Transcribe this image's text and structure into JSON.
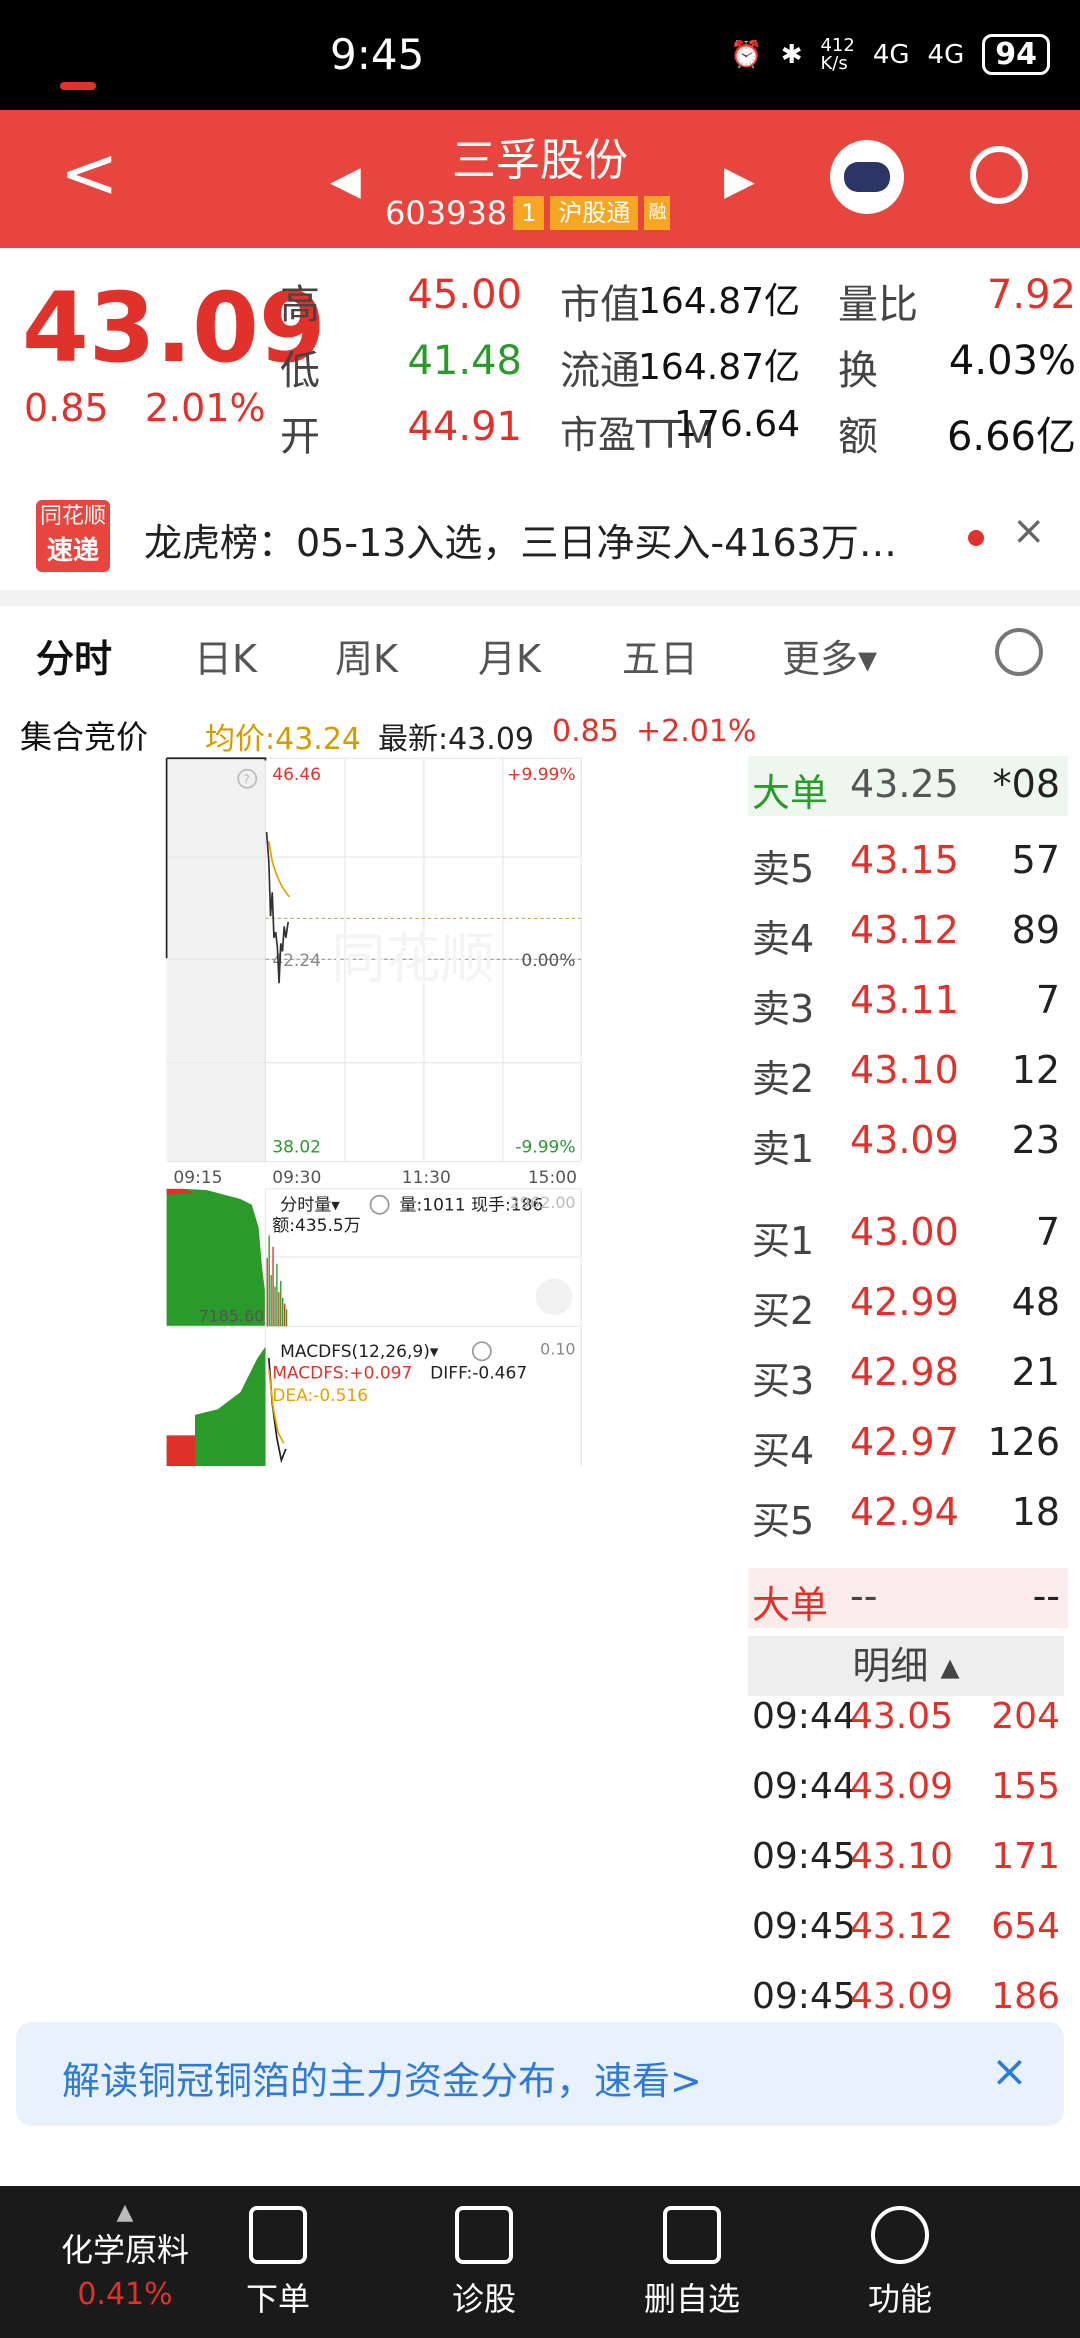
{
  "status": {
    "time": "9:45",
    "net_speed": "412\nK/s",
    "signal1": "4G",
    "signal2": "4G",
    "battery": "94"
  },
  "header": {
    "back": "<",
    "stock_name": "三孚股份",
    "stock_code": "603938",
    "tag_level": "1",
    "tag_connect": "沪股通",
    "tag_extra": "融"
  },
  "quote": {
    "price": "43.09",
    "change": "0.85",
    "change_pct": "2.01%",
    "rows": [
      {
        "l1": "高",
        "v1": "45.00",
        "c1": "red",
        "l2": "市值",
        "v2": "164.87亿",
        "l3": "量比",
        "v3": "7.92",
        "c3": "red"
      },
      {
        "l1": "低",
        "v1": "41.48",
        "c1": "green",
        "l2": "流通",
        "v2": "164.87亿",
        "l3": "换",
        "v3": "4.03%",
        "c3": "black"
      },
      {
        "l1": "开",
        "v1": "44.91",
        "c1": "red",
        "l2": "市盈TTM",
        "v2": "176.64",
        "l3": "额",
        "v3": "6.66亿",
        "c3": "black"
      }
    ]
  },
  "lhb": {
    "logo_top": "同花顺",
    "logo_bottom": "速递",
    "text": "龙虎榜：05-13入选，三日净买入-4163万…",
    "close": "×"
  },
  "tabs": [
    "分时",
    "日K",
    "周K",
    "月K",
    "五日",
    "更多▾"
  ],
  "info": {
    "auction": "集合竞价",
    "avg": "均价:43.24",
    "latest": "最新:43.09",
    "chg": "0.85",
    "pct": "+2.01%"
  },
  "chart": {
    "top_price": "46.46",
    "top_pct": "+9.99%",
    "mid_price": "42.24",
    "mid_pct": "0.00%",
    "bottom_price": "38.02",
    "bottom_pct": "-9.99%",
    "times": [
      "09:15",
      "09:30",
      "11:30",
      "15:00"
    ],
    "vol_label": "分时量▾",
    "vol_info": "量:1011  现手:186",
    "vol_max": "2962.00",
    "amount": "额:435.5万",
    "auction_val": "7185.60",
    "macd_label": "MACDFS(12,26,9)▾",
    "macd_max": "0.10",
    "macd_val": "MACDFS:+0.097",
    "diff": "DIFF:-0.467",
    "dea": "DEA:-0.516",
    "watermark": "同花顺"
  },
  "big_order": {
    "label": "大单",
    "price": "43.25",
    "vol": "*08"
  },
  "asks": [
    {
      "label": "卖5",
      "price": "43.15",
      "vol": "57"
    },
    {
      "label": "卖4",
      "price": "43.12",
      "vol": "89"
    },
    {
      "label": "卖3",
      "price": "43.11",
      "vol": "7"
    },
    {
      "label": "卖2",
      "price": "43.10",
      "vol": "12"
    },
    {
      "label": "卖1",
      "price": "43.09",
      "vol": "23"
    }
  ],
  "bids": [
    {
      "label": "买1",
      "price": "43.00",
      "vol": "7"
    },
    {
      "label": "买2",
      "price": "42.99",
      "vol": "48"
    },
    {
      "label": "买3",
      "price": "42.98",
      "vol": "21"
    },
    {
      "label": "买4",
      "price": "42.97",
      "vol": "126"
    },
    {
      "label": "买5",
      "price": "42.94",
      "vol": "18"
    }
  ],
  "big_order2": {
    "label": "大单",
    "price": "--",
    "vol": "--"
  },
  "detail": {
    "label": "明细 ▴"
  },
  "ticks": [
    {
      "time": "09:44",
      "price": "43.05",
      "vol": "204"
    },
    {
      "time": "09:44",
      "price": "43.09",
      "vol": "155"
    },
    {
      "time": "09:45",
      "price": "43.10",
      "vol": "171"
    },
    {
      "time": "09:45",
      "price": "43.12",
      "vol": "654"
    },
    {
      "time": "09:45",
      "price": "43.09",
      "vol": "186"
    }
  ],
  "ad": {
    "text": "解读铜冠铜箔的主力资金分布，速看>",
    "close": "×"
  },
  "nav": {
    "sector": "化学原料",
    "sector_pct": "0.41%",
    "items": [
      "下单",
      "诊股",
      "删自选",
      "功能"
    ]
  }
}
